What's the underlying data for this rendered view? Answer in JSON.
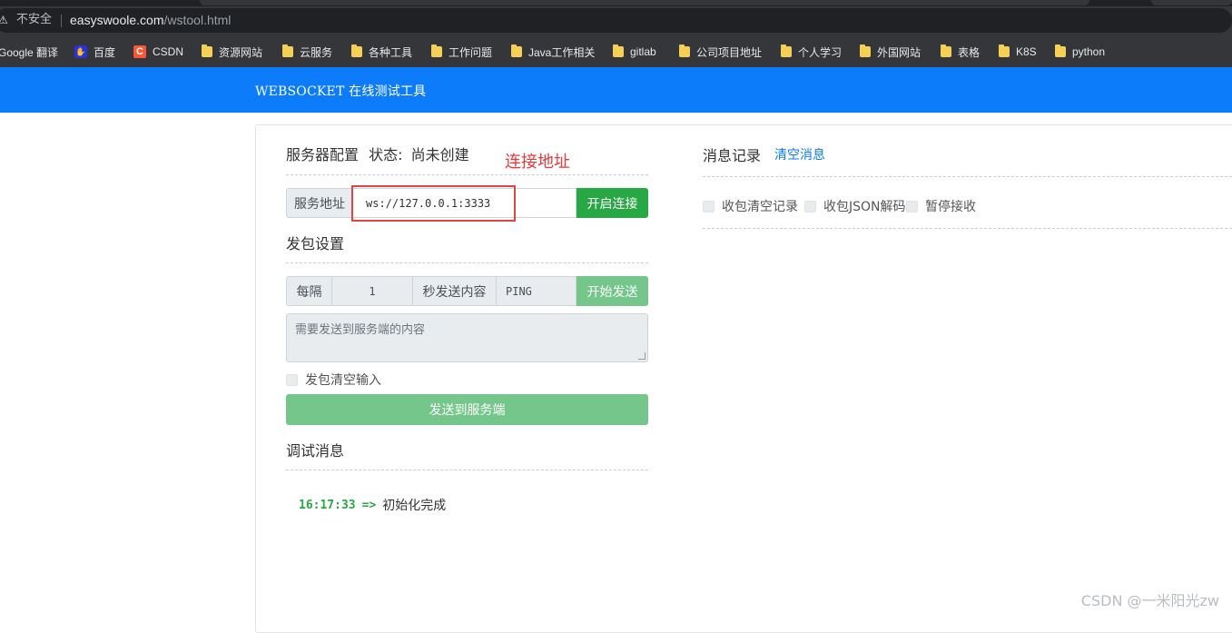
{
  "browser": {
    "security_warning_glyph": "⚠",
    "security_label": "不安全",
    "url_host": "easyswoole.com",
    "url_path": "/wstool.html",
    "bookmarks": [
      {
        "label": "Google 翻译",
        "icon": "google-translate"
      },
      {
        "label": "百度",
        "icon": "baidu"
      },
      {
        "label": "CSDN",
        "icon": "csdn"
      },
      {
        "label": "资源网站",
        "icon": "folder"
      },
      {
        "label": "云服务",
        "icon": "folder"
      },
      {
        "label": "各种工具",
        "icon": "folder"
      },
      {
        "label": "工作问题",
        "icon": "folder"
      },
      {
        "label": "Java工作相关",
        "icon": "folder"
      },
      {
        "label": "gitlab",
        "icon": "folder"
      },
      {
        "label": "公司项目地址",
        "icon": "folder"
      },
      {
        "label": "个人学习",
        "icon": "folder"
      },
      {
        "label": "外国网站",
        "icon": "folder"
      },
      {
        "label": "表格",
        "icon": "folder"
      },
      {
        "label": "K8S",
        "icon": "folder"
      },
      {
        "label": "python",
        "icon": "folder"
      }
    ]
  },
  "navbar": {
    "brand": "WEBSOCKET 在线测试工具",
    "color": "#0d7cfa"
  },
  "server": {
    "title": "服务器配置",
    "status_label": "状态:",
    "status_value": "尚未创建",
    "address_label": "服务地址",
    "address_value": "ws://127.0.0.1:3333",
    "connect_button": "开启连接"
  },
  "annotation": {
    "text": "连接地址",
    "color": "#e83a3a"
  },
  "send_settings": {
    "title": "发包设置",
    "every_label": "每隔",
    "interval_value": "1",
    "seconds_send_label": "秒发送内容",
    "content_value": "PING",
    "start_button": "开始发送",
    "textarea_placeholder": "需要发送到服务端的内容",
    "clear_input_label": "发包清空输入",
    "send_button": "发送到服务端"
  },
  "debug": {
    "title": "调试消息",
    "entries": [
      {
        "time": "16:17:33",
        "arrow": "=>",
        "message": "初始化完成"
      }
    ]
  },
  "messages": {
    "title": "消息记录",
    "clear_link": "清空消息",
    "options": [
      {
        "label": "收包清空记录"
      },
      {
        "label": "收包JSON解码"
      },
      {
        "label": "暂停接收"
      }
    ]
  },
  "watermark": "CSDN @一米阳光zw",
  "colors": {
    "success": "#28a745",
    "success_light": "#74c68a",
    "primary": "#0d7cfa"
  }
}
